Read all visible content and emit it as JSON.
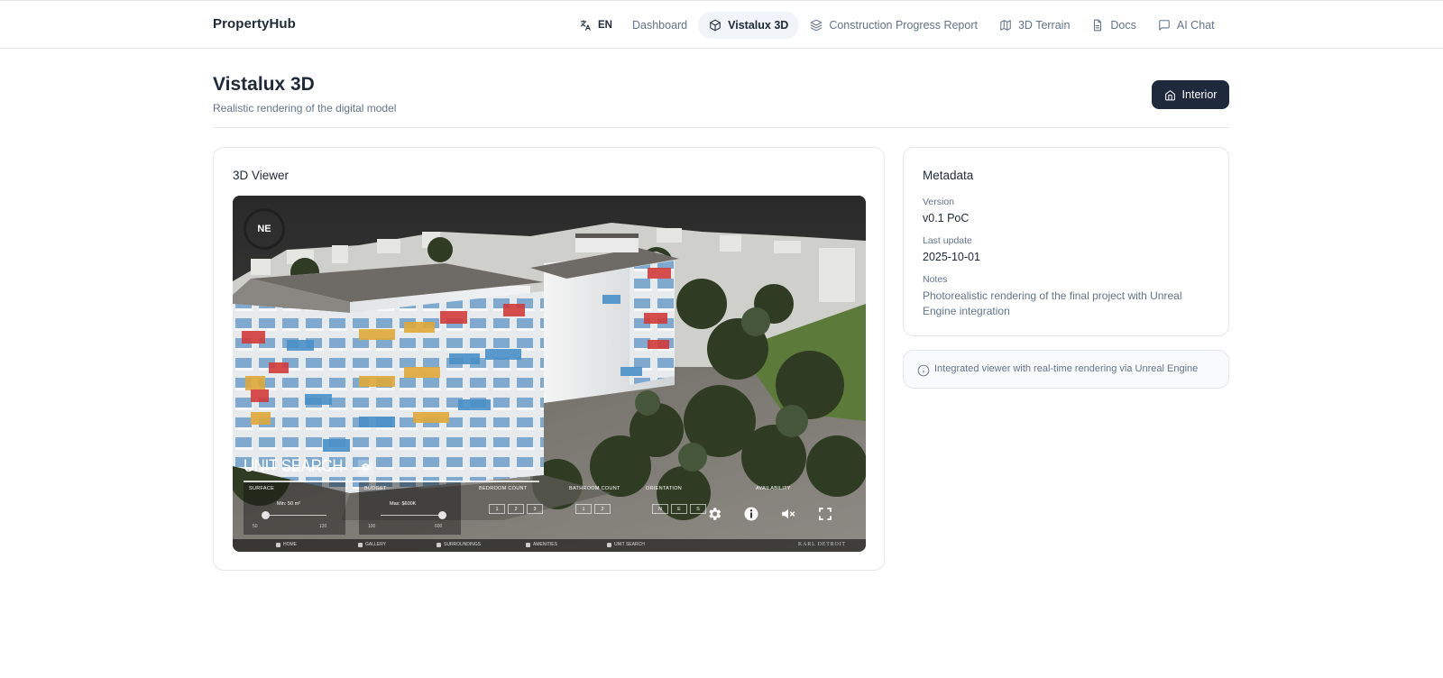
{
  "app": {
    "brand": "PropertyHub"
  },
  "nav": {
    "language": "EN",
    "items": [
      {
        "label": "Dashboard",
        "icon": "",
        "active": false
      },
      {
        "label": "Vistalux 3D",
        "icon": "cube-icon",
        "active": true
      },
      {
        "label": "Construction Progress Report",
        "icon": "layers-icon",
        "active": false
      },
      {
        "label": "3D Terrain",
        "icon": "map-icon",
        "active": false
      },
      {
        "label": "Docs",
        "icon": "document-icon",
        "active": false
      },
      {
        "label": "AI Chat",
        "icon": "chat-icon",
        "active": false
      }
    ]
  },
  "page": {
    "title": "Vistalux 3D",
    "subtitle": "Realistic rendering of the digital model",
    "interior_button": "Interior"
  },
  "viewer": {
    "card_title": "3D Viewer",
    "compass": "NE",
    "unit_search_title": "UNIT SEARCH",
    "filters": {
      "surface": {
        "label": "SURFACE",
        "value": "Min: 50 m²",
        "min": "50",
        "max": "120",
        "level": 0.0
      },
      "budget": {
        "label": "BUDGET",
        "value": "Max: $600K",
        "min": "100",
        "max": "600",
        "level": 1.0
      },
      "bedroom": {
        "label": "BEDROOM COUNT",
        "options": [
          "1",
          "2",
          "3"
        ]
      },
      "bathroom": {
        "label": "BATHROOM COUNT",
        "options": [
          "1",
          "2"
        ]
      },
      "orientation": {
        "label": "ORIENTATION",
        "options": [
          "N",
          "E",
          "S"
        ]
      },
      "availability": {
        "label": "AVAILABILITY"
      }
    },
    "controls": [
      "settings-icon",
      "info-icon",
      "mute-icon",
      "fullscreen-icon"
    ],
    "bottom_nav": [
      "HOME",
      "GALLERY",
      "SURROUNDINGS",
      "AMENITIES",
      "UNIT SEARCH"
    ],
    "watermark": "KARL DETROIT"
  },
  "metadata": {
    "title": "Metadata",
    "version_label": "Version",
    "version": "v0.1 PoC",
    "last_update_label": "Last update",
    "last_update": "2025-10-01",
    "notes_label": "Notes",
    "notes": "Photorealistic rendering of the final project with Unreal Engine integration"
  },
  "info": {
    "text": "Integrated viewer with real-time rendering via Unreal Engine"
  },
  "colors": {
    "primary_dark": "#1e293b",
    "muted_text": "#64748b",
    "border": "#e5e7eb",
    "active_nav_bg": "#f1f5f9",
    "balcony_blue": "#4a90c8",
    "balcony_red": "#d23b3b",
    "balcony_yellow": "#e0a93a"
  }
}
